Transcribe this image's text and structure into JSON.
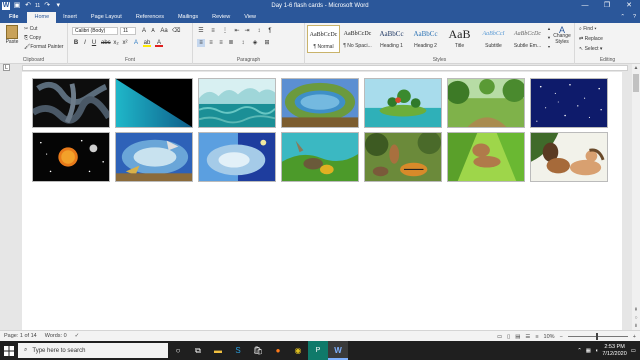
{
  "window": {
    "title": "Day 1-6 flash cards  -  Microsoft Word",
    "qat_undo_count": "11"
  },
  "tabs": [
    "File",
    "Home",
    "Insert",
    "Page Layout",
    "References",
    "Mailings",
    "Review",
    "View"
  ],
  "active_tab": "Home",
  "ribbon": {
    "clipboard": {
      "paste": "Paste",
      "cut": "Cut",
      "copy": "Copy",
      "format_painter": "Format Painter",
      "label": "Clipboard"
    },
    "font": {
      "family": "Calibri (Body)",
      "size": "11",
      "label": "Font"
    },
    "paragraph": {
      "label": "Paragraph"
    },
    "styles": {
      "items": [
        {
          "sample": "AaBbCcDc",
          "name": "¶ Normal"
        },
        {
          "sample": "AaBbCcDc",
          "name": "¶ No Spaci..."
        },
        {
          "sample": "AaBbCc",
          "name": "Heading 1"
        },
        {
          "sample": "AaBbCc",
          "name": "Heading 2"
        },
        {
          "sample": "AaB",
          "name": "Title"
        },
        {
          "sample": "AaBbCcI",
          "name": "Subtitle"
        },
        {
          "sample": "AaBbCcDc",
          "name": "Subtle Em..."
        }
      ],
      "change_styles": "Change Styles",
      "label": "Styles"
    },
    "editing": {
      "find": "Find",
      "replace": "Replace",
      "select": "Select",
      "label": "Editing"
    }
  },
  "status": {
    "page": "Page: 1 of 14",
    "words": "Words: 0",
    "zoom": "10%"
  },
  "taskbar": {
    "search_placeholder": "Type here to search",
    "time": "2:53 PM",
    "date": "7/12/2020"
  },
  "colors": {
    "word_blue": "#2b579a"
  }
}
